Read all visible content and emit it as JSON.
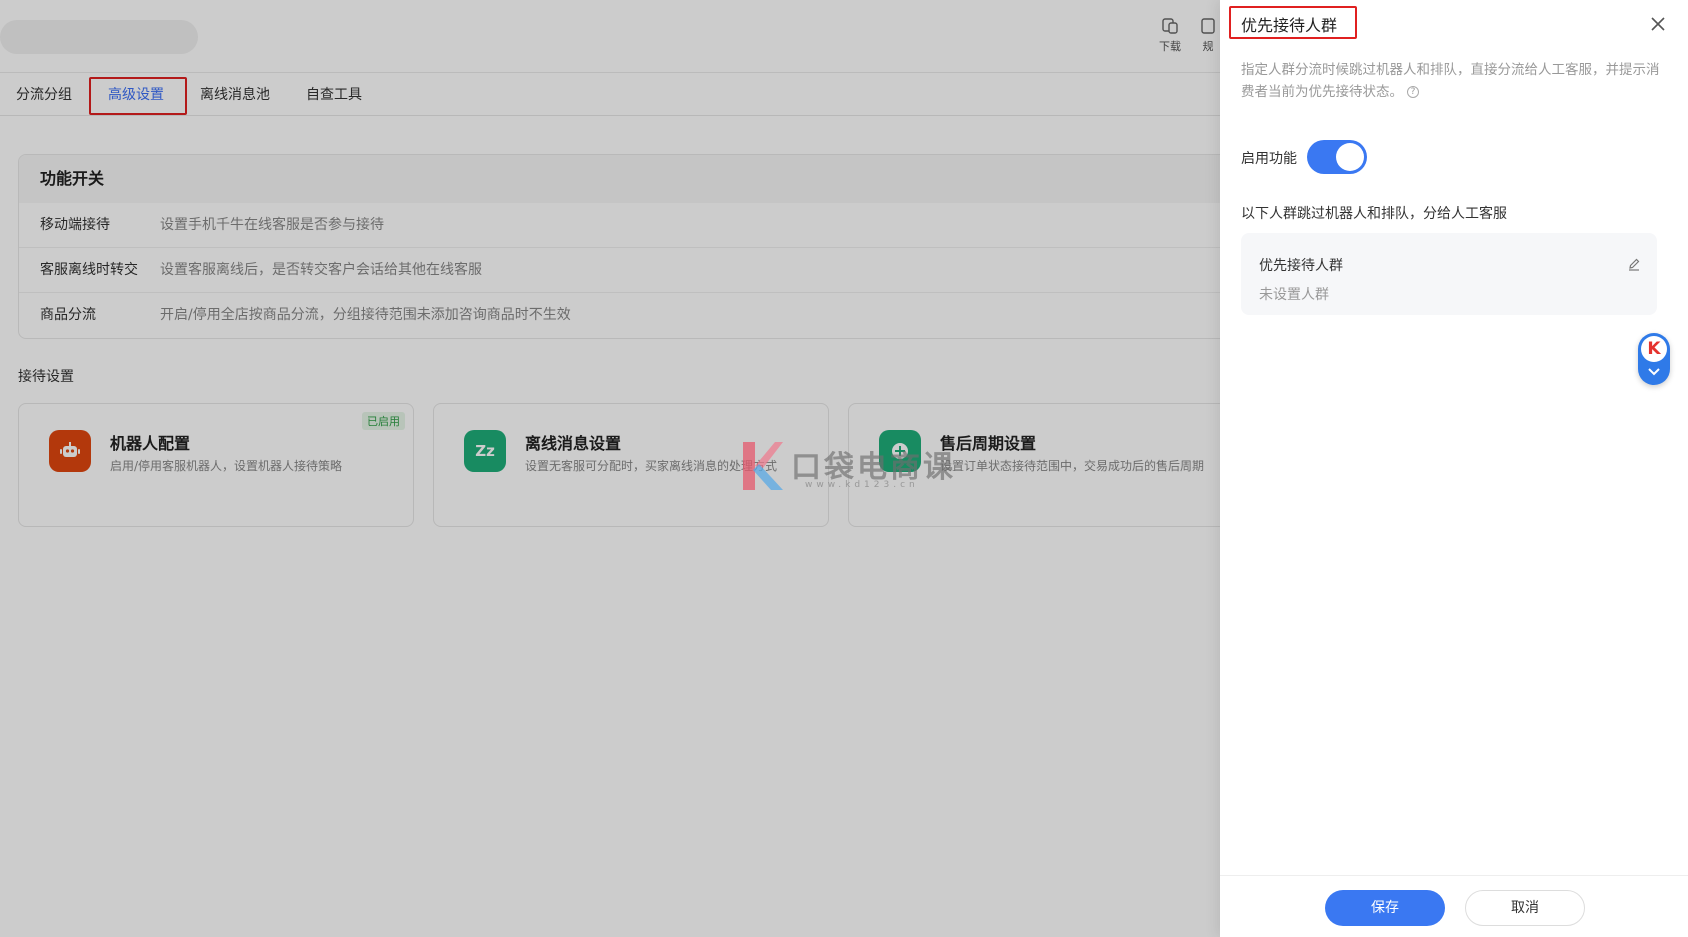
{
  "header": {
    "tools": [
      {
        "label": "下载",
        "icon": "download-icon"
      },
      {
        "label": "规",
        "icon": "rules-icon"
      }
    ]
  },
  "tabs": [
    {
      "label": "分流分组",
      "active": false
    },
    {
      "label": "高级设置",
      "active": true
    },
    {
      "label": "离线消息池",
      "active": false
    },
    {
      "label": "自查工具",
      "active": false
    }
  ],
  "function_panel": {
    "title": "功能开关",
    "rows": [
      {
        "label": "移动端接待",
        "desc": "设置手机千牛在线客服是否参与接待"
      },
      {
        "label": "客服离线时转交",
        "desc": "设置客服离线后，是否转交客户会话给其他在线客服"
      },
      {
        "label": "商品分流",
        "desc": "开启/停用全店按商品分流，分组接待范围未添加咨询商品时不生效"
      }
    ]
  },
  "reception": {
    "title": "接待设置",
    "cards": [
      {
        "title": "机器人配置",
        "desc": "启用/停用客服机器人，设置机器人接待策略",
        "badge": "已启用",
        "icon": "robot-icon",
        "color": "#e0470f"
      },
      {
        "title": "离线消息设置",
        "desc": "设置无客服可分配时，买家离线消息的处理方式",
        "badge": "",
        "icon": "sleep-zz-icon",
        "color": "#1fae7a"
      },
      {
        "title": "售后周期设置",
        "desc": "设置订单状态接待范围中，交易成功后的售后周期",
        "badge": "",
        "icon": "plus-circle-icon",
        "color": "#1fae7a"
      }
    ]
  },
  "watermark": {
    "text": "口袋电商课",
    "url": "www.kd123.cn"
  },
  "drawer": {
    "title": "优先接待人群",
    "description": "指定人群分流时候跳过机器人和排队，直接分流给人工客服，并提示消费者当前为优先接待状态。",
    "toggle_label": "启用功能",
    "toggle_on": true,
    "group_label": "以下人群跳过机器人和排队，分给人工客服",
    "group_name": "优先接待人群",
    "group_value": "未设置人群",
    "save_label": "保存",
    "cancel_label": "取消"
  },
  "colors": {
    "accent": "#3a78f2",
    "highlight_box": "#e02020"
  }
}
